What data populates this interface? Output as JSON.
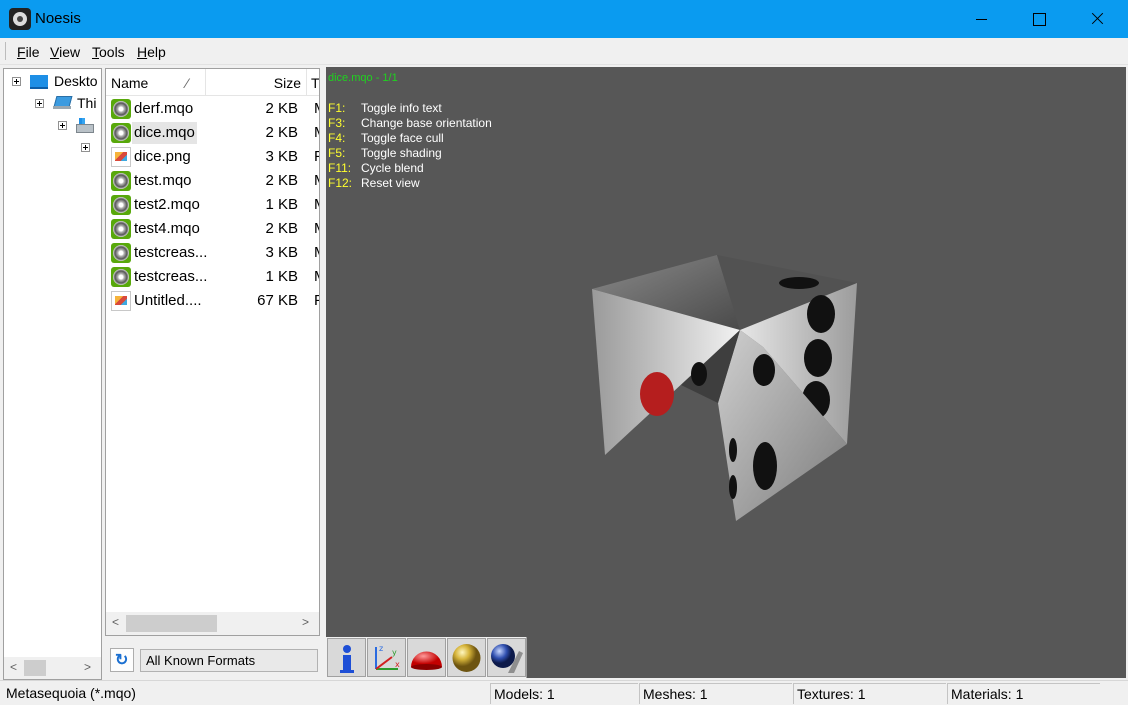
{
  "window": {
    "title": "Noesis"
  },
  "menu": [
    "File",
    "View",
    "Tools",
    "Help"
  ],
  "tree": [
    {
      "label": "Deskto",
      "icon": "desktop-icon"
    },
    {
      "label": "Thi",
      "icon": "computer-icon"
    },
    {
      "label": "",
      "icon": "windows-drive-icon"
    },
    {
      "label": "",
      "icon": "expander"
    }
  ],
  "file_list": {
    "columns": {
      "name": "Name",
      "sort_glyph": "⁄",
      "size": "Size",
      "type": "T"
    },
    "files": [
      {
        "name": "derf.mqo",
        "size": "2 KB",
        "type": "M",
        "icon": "mqo-file-icon"
      },
      {
        "name": "dice.mqo",
        "size": "2 KB",
        "type": "M",
        "icon": "mqo-file-icon",
        "selected": true
      },
      {
        "name": "dice.png",
        "size": "3 KB",
        "type": "P",
        "icon": "png-file-icon"
      },
      {
        "name": "test.mqo",
        "size": "2 KB",
        "type": "M",
        "icon": "mqo-file-icon"
      },
      {
        "name": "test2.mqo",
        "size": "1 KB",
        "type": "M",
        "icon": "mqo-file-icon"
      },
      {
        "name": "test4.mqo",
        "size": "2 KB",
        "type": "M",
        "icon": "mqo-file-icon"
      },
      {
        "name": "testcreas...",
        "size": "3 KB",
        "type": "M",
        "icon": "mqo-file-icon"
      },
      {
        "name": "testcreas...",
        "size": "1 KB",
        "type": "M",
        "icon": "mqo-file-icon"
      },
      {
        "name": "Untitled....",
        "size": "67 KB",
        "type": "P",
        "icon": "png-file-icon"
      }
    ]
  },
  "format_filter": {
    "value": "All Known Formats"
  },
  "viewport": {
    "title": "dice.mqo - 1/1",
    "info": [
      {
        "key": "F1:",
        "text": "Toggle info text"
      },
      {
        "key": "F3:",
        "text": "Change base orientation"
      },
      {
        "key": "F4:",
        "text": "Toggle face cull"
      },
      {
        "key": "F5:",
        "text": "Toggle shading"
      },
      {
        "key": "F11:",
        "text": "Cycle blend"
      },
      {
        "key": "F12:",
        "text": "Reset view"
      }
    ],
    "toolbar": [
      "info-icon",
      "axes-icon",
      "red-dome-icon",
      "gold-sphere-icon",
      "wrench-sphere-icon"
    ]
  },
  "status": {
    "format": "Metasequoia (*.mqo)",
    "models": "Models: 1",
    "meshes": "Meshes: 1",
    "textures": "Textures: 1",
    "materials": "Materials: 1"
  }
}
